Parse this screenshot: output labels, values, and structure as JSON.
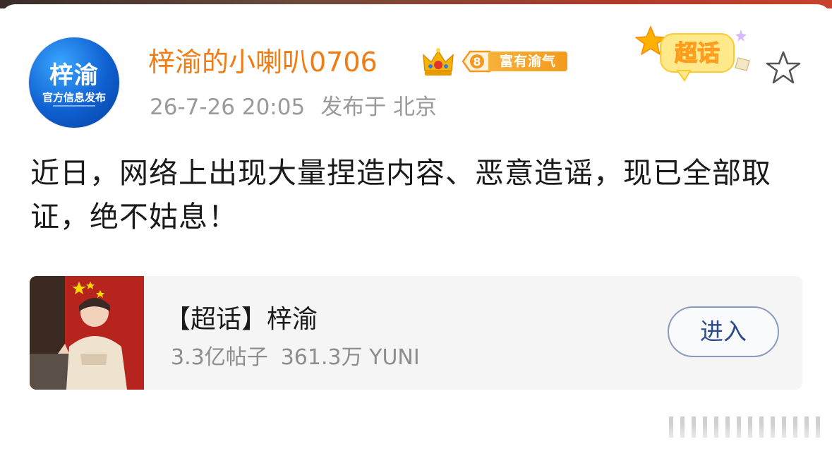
{
  "post": {
    "author": {
      "name": "梓渝的小喇叭0706",
      "avatar_main": "梓渝",
      "avatar_sub": "官方信息发布",
      "level": "8",
      "level_tag": "富有渝气"
    },
    "time": "26-7-26 20:05",
    "location": "发布于 北京",
    "content": "近日，网络上出现大量捏造内容、恶意造谣，现已全部取证，绝不姑息！",
    "super_topic_sticker": "超话"
  },
  "topic_card": {
    "title": "【超话】梓渝",
    "posts": "3.3亿帖子",
    "fans": "361.3万 YUNI",
    "enter_label": "进入"
  },
  "icons": [
    "crown-icon",
    "level-badge-icon",
    "super-topic-sticker-icon",
    "star-icon"
  ],
  "colors": {
    "username": "#f07c13",
    "meta": "#9a9a9a",
    "badge": "#f39a1e",
    "button_text": "#2d4a8a"
  }
}
